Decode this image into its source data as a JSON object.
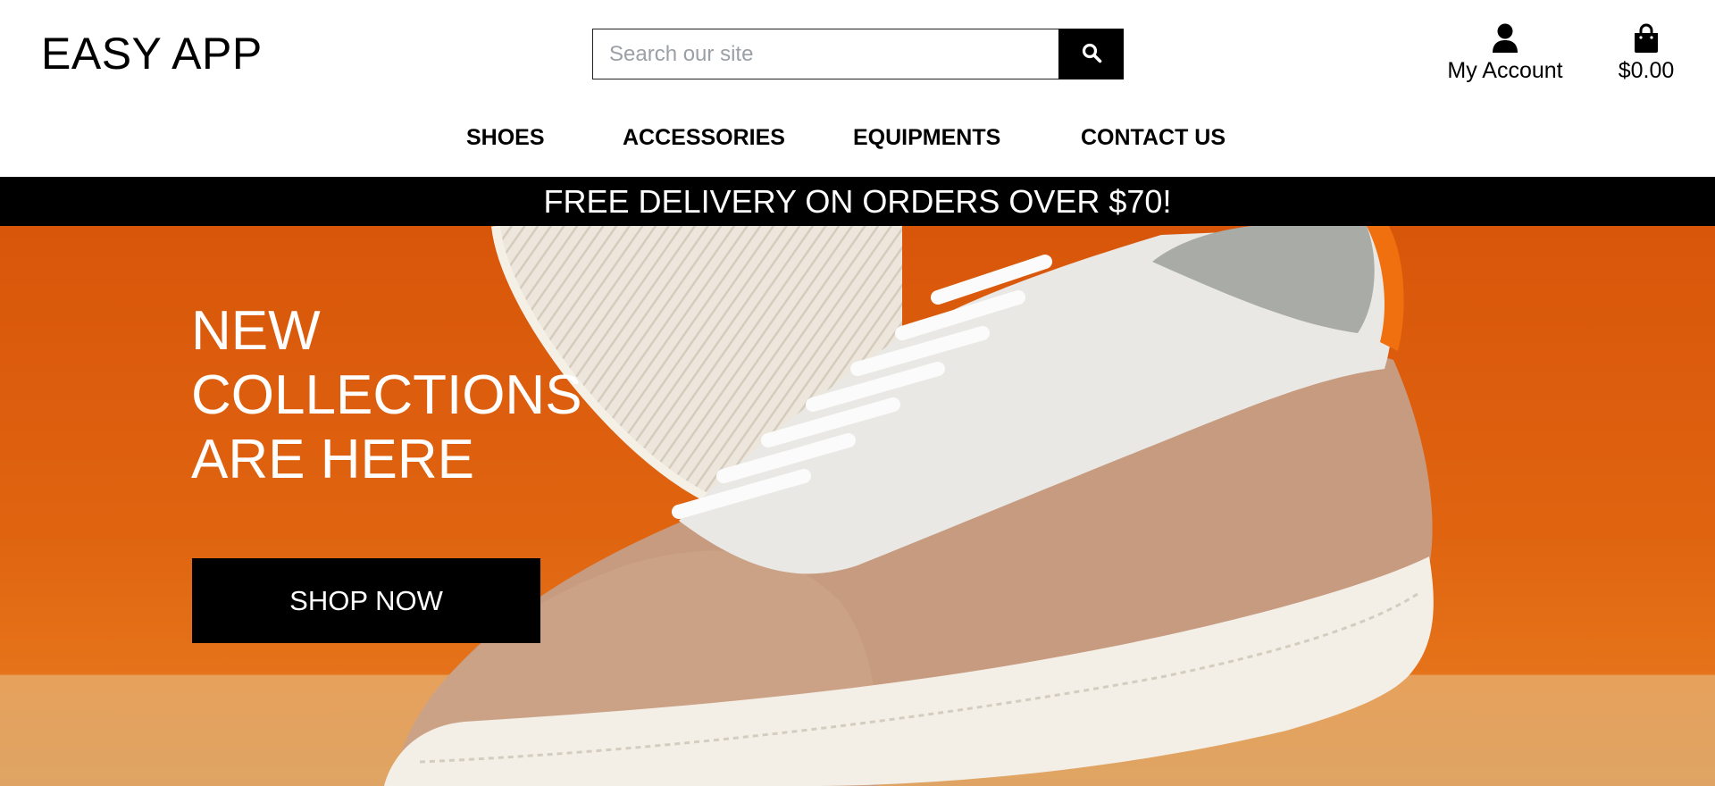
{
  "header": {
    "logo": "EASY APP",
    "search": {
      "placeholder": "Search our site",
      "value": ""
    },
    "account_label": "My Account",
    "cart_total": "$0.00"
  },
  "nav": {
    "items": [
      {
        "label": "SHOES"
      },
      {
        "label": "ACCESSORIES"
      },
      {
        "label": "EQUIPMENTS"
      },
      {
        "label": "CONTACT US"
      }
    ]
  },
  "promo": {
    "text": "FREE DELIVERY ON ORDERS OVER $70!"
  },
  "hero": {
    "title_lines": [
      "NEW",
      "COLLECTIONS",
      "ARE HERE"
    ],
    "cta_label": "SHOP NOW"
  },
  "icons": {
    "search": "search-icon",
    "account": "user-icon",
    "cart": "shopping-bag-icon"
  },
  "colors": {
    "hero_orange": "#d8560a",
    "floor_tan": "#e6a15c",
    "promo_bg": "#000000",
    "button_bg": "#000000"
  }
}
